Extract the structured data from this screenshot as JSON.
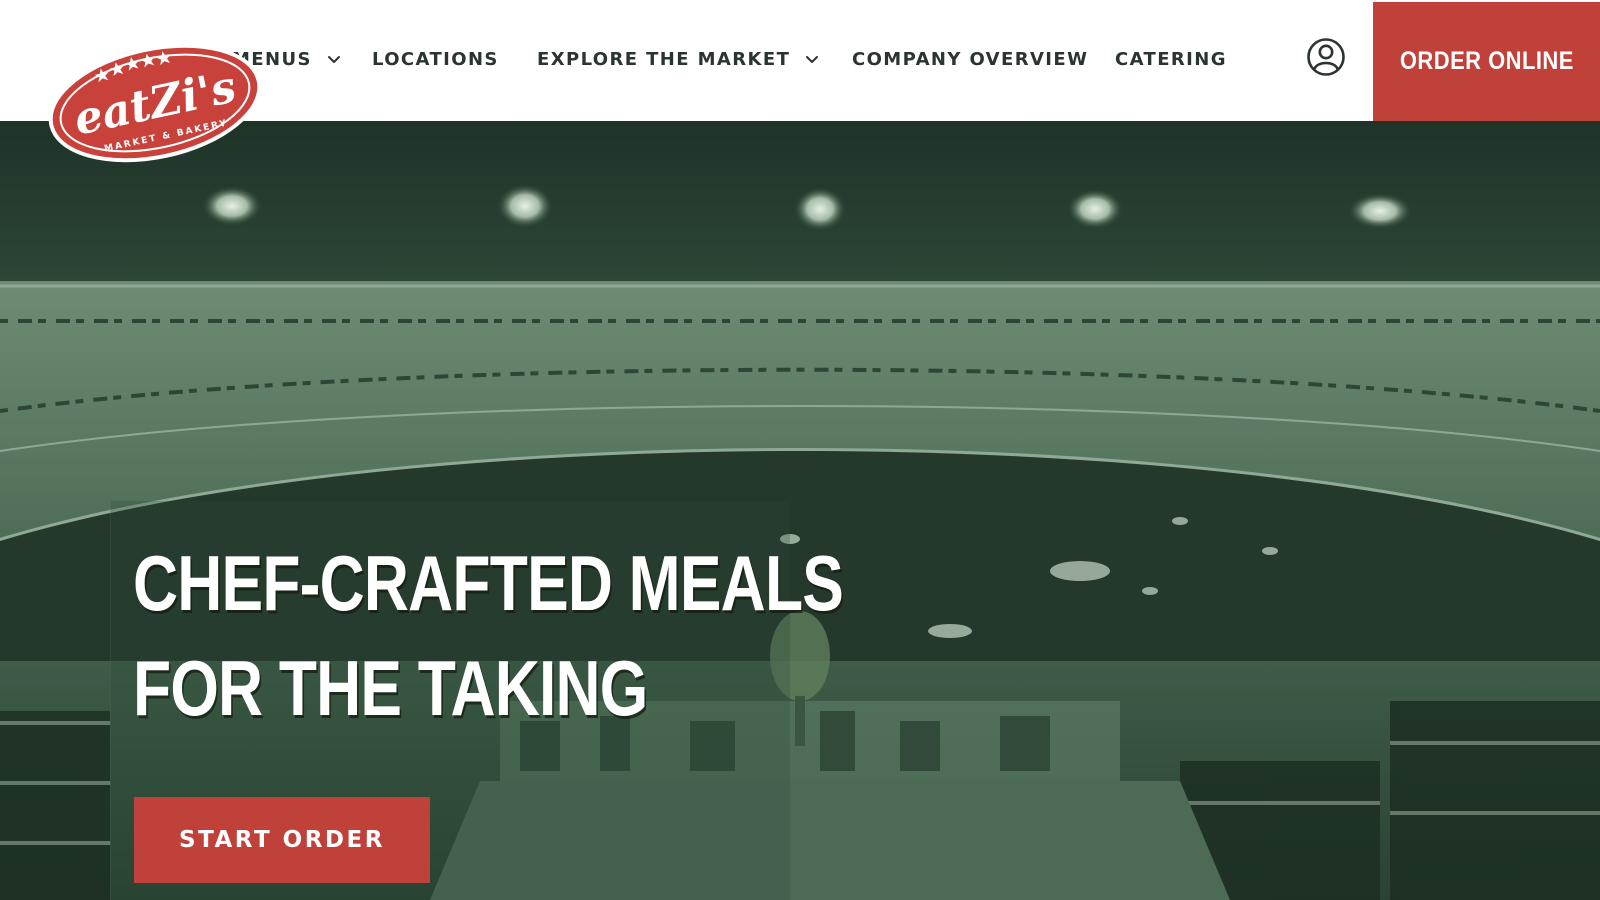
{
  "logo": {
    "wordmark": "eatZi's",
    "tagline": "MARKET & BAKERY"
  },
  "nav": {
    "items": [
      {
        "label": "MENUS",
        "has_dropdown": true
      },
      {
        "label": "LOCATIONS",
        "has_dropdown": false
      },
      {
        "label": "EXPLORE THE MARKET",
        "has_dropdown": true
      },
      {
        "label": "COMPANY OVERVIEW",
        "has_dropdown": false
      },
      {
        "label": "CATERING",
        "has_dropdown": false
      }
    ],
    "account_icon": "user-circle-icon",
    "order_online_label": "ORDER ONLINE"
  },
  "hero": {
    "headline_line1": "CHEF-CRAFTED MEALS",
    "headline_line2": "FOR THE TAKING",
    "cta_label": "START ORDER"
  },
  "colors": {
    "brand_red": "#c0403a",
    "nav_text": "#2b3530",
    "hero_tint": "#3a5a44"
  }
}
